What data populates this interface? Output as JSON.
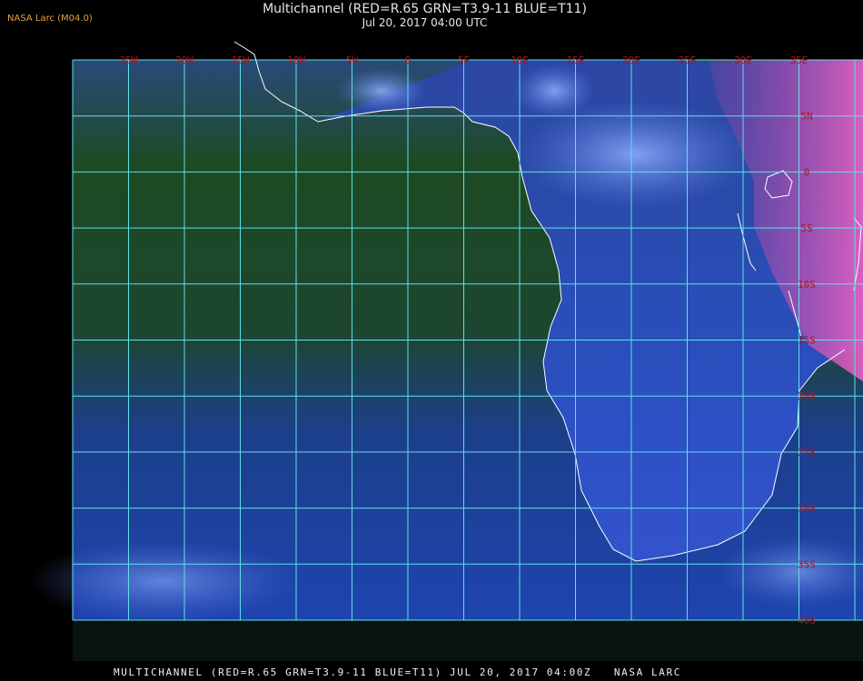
{
  "header": {
    "badge": "NASA Larc (M04.0)",
    "title": "Multichannel (RED=R.65 GRN=T3.9-11 BLUE=T11)",
    "datetime": "Jul 20, 2017 04:00 UTC"
  },
  "map": {
    "lon_labels": [
      "25W",
      "20W",
      "15W",
      "10W",
      "5W",
      "0",
      "5E",
      "10E",
      "15E",
      "20E",
      "25E",
      "30E",
      "35E"
    ],
    "lat_labels": [
      "5N",
      "0",
      "5S",
      "10S",
      "15S",
      "20S",
      "25S",
      "30S",
      "35S",
      "40S"
    ],
    "colors": {
      "grid": "#5fe0e8",
      "label": "#b0141a",
      "coast": "#ffffff",
      "ocean_north": "#1e4a1a",
      "ocean_south": "#1a3fb0",
      "land_hot": "#d050b0"
    }
  },
  "footer": {
    "caption": "MULTICHANNEL (RED=R.65 GRN=T3.9-11 BLUE=T11) JUL 20, 2017 04:00Z   NASA LARC"
  }
}
